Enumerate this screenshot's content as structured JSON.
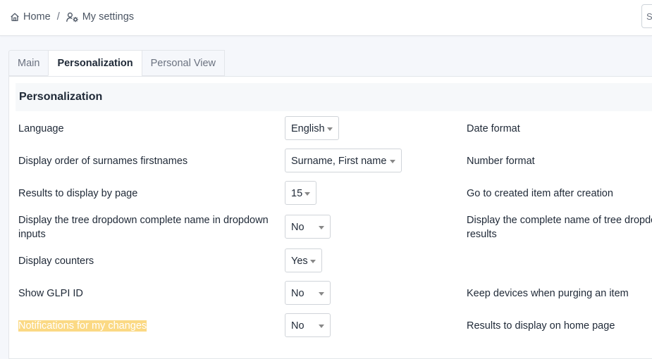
{
  "breadcrumb": {
    "home_label": "Home",
    "separator": "/",
    "settings_label": "My settings"
  },
  "search_stub": "S",
  "tabs": [
    {
      "label": "Main",
      "active": false
    },
    {
      "label": "Personalization",
      "active": true
    },
    {
      "label": "Personal View",
      "active": false
    }
  ],
  "section_title": "Personalization",
  "left_fields": [
    {
      "label": "Language",
      "value": "English"
    },
    {
      "label": "Display order of surnames firstnames",
      "value": "Surname, First name"
    },
    {
      "label": "Results to display by page",
      "value": "15"
    },
    {
      "label": "Display the tree dropdown complete name in dropdown inputs",
      "value": "No"
    },
    {
      "label": "Display counters",
      "value": "Yes"
    },
    {
      "label": "Show GLPI ID",
      "value": "No"
    },
    {
      "label": "Notifications for my changes",
      "value": "No"
    }
  ],
  "right_labels": [
    "Date format",
    "Number format",
    "Go to created item after creation",
    "Display the complete name of tree dropdown results",
    "",
    "Keep devices when purging an item",
    "Results to display on home page"
  ],
  "colors": {
    "highlight": "#fbd984",
    "background": "#f5f7fb"
  }
}
